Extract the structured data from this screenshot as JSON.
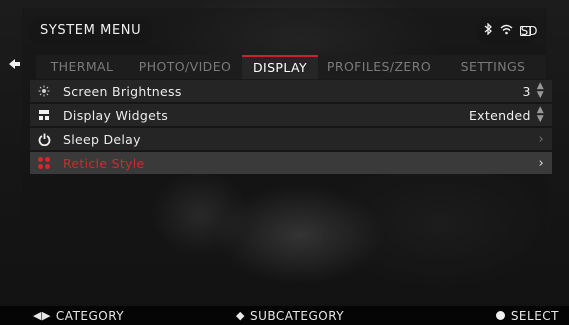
{
  "header": {
    "title": "SYSTEM MENU",
    "status_icons": [
      "bluetooth-icon",
      "wifi-icon",
      "sd-card-icon"
    ],
    "sd_label": "SD"
  },
  "tabs": [
    {
      "label": "THERMAL",
      "active": false
    },
    {
      "label": "PHOTO/VIDEO",
      "active": false
    },
    {
      "label": "DISPLAY",
      "active": true
    },
    {
      "label": "PROFILES/ZERO",
      "active": false
    },
    {
      "label": "SETTINGS",
      "active": false
    }
  ],
  "menu": [
    {
      "label": "Screen Brightness",
      "value": "3",
      "control": "stepper",
      "icon": "brightness-icon"
    },
    {
      "label": "Display Widgets",
      "value": "Extended",
      "control": "stepper",
      "icon": "widgets-icon"
    },
    {
      "label": "Sleep Delay",
      "value": "",
      "control": "submenu",
      "icon": "power-icon"
    },
    {
      "label": "Reticle Style",
      "value": "",
      "control": "submenu",
      "icon": "reticle-dots-icon",
      "selected": true
    }
  ],
  "footer": {
    "category": "CATEGORY",
    "subcategory": "SUBCATEGORY",
    "select": "SELECT"
  },
  "colors": {
    "accent": "#d8262e",
    "tab_inactive": "#7a7a7a",
    "background": "#0b0b0b"
  }
}
